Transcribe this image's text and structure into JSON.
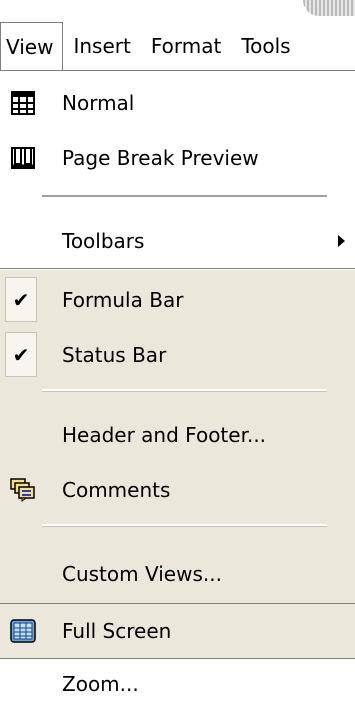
{
  "menubar": {
    "items": [
      {
        "label": "View",
        "active": true
      },
      {
        "label": "Insert"
      },
      {
        "label": "Format"
      },
      {
        "label": "Tools"
      }
    ]
  },
  "view_menu": {
    "normal": {
      "label": "Normal",
      "icon": "normal-view-icon"
    },
    "page_break_preview": {
      "label": "Page Break Preview",
      "icon": "page-break-preview-icon"
    },
    "toolbars": {
      "label": "Toolbars",
      "submenu": true
    },
    "formula_bar": {
      "label": "Formula Bar",
      "checked": true
    },
    "status_bar": {
      "label": "Status Bar",
      "checked": true
    },
    "header_footer": {
      "label": "Header and Footer..."
    },
    "comments": {
      "label": "Comments",
      "icon": "comments-icon"
    },
    "custom_views": {
      "label": "Custom Views..."
    },
    "full_screen": {
      "label": "Full Screen",
      "icon": "full-screen-icon"
    },
    "zoom": {
      "label": "Zoom..."
    },
    "check_glyph": "✔"
  },
  "colors": {
    "menu_bg": "#ffffff",
    "highlight_band": "#ebe7db",
    "border": "#7f7f7f"
  }
}
